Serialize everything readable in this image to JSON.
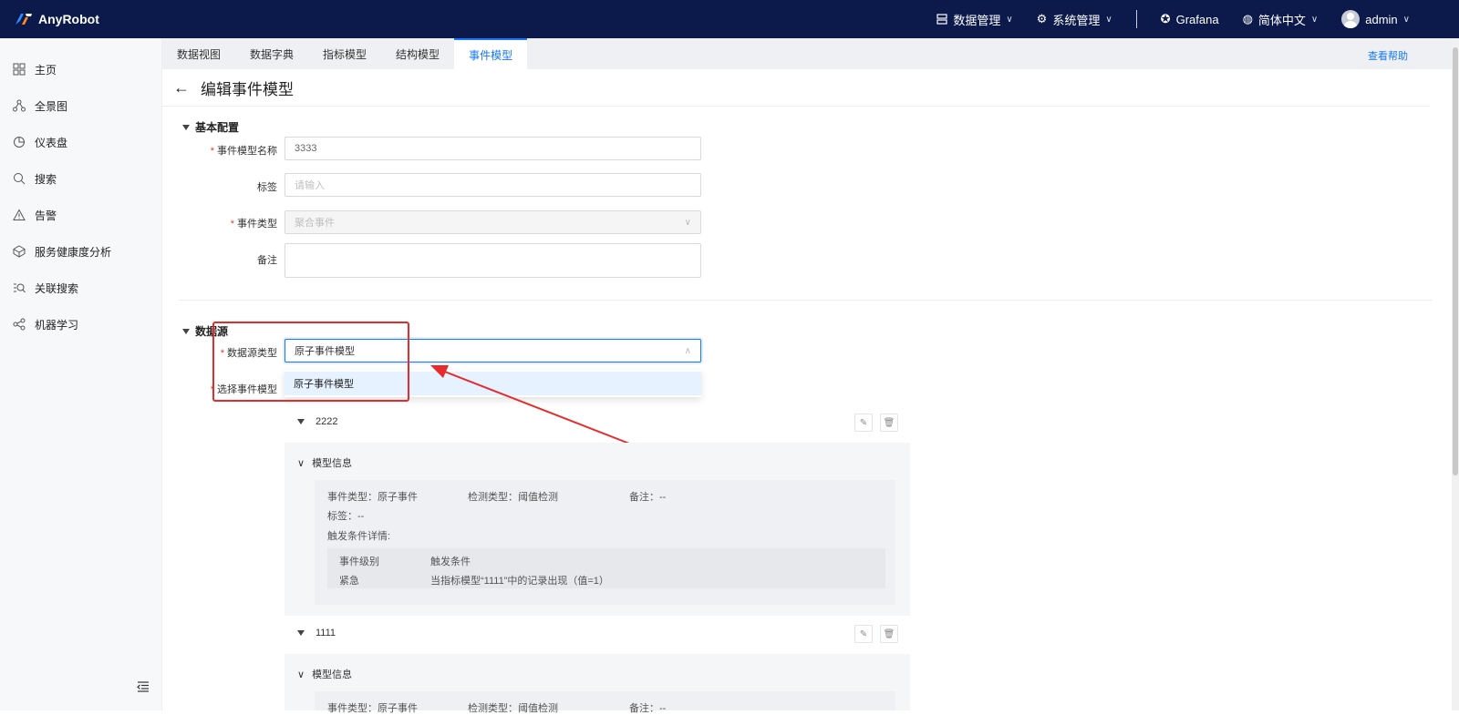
{
  "app": {
    "name": "AnyRobot",
    "colors": {
      "topbar": "#0b1a4a",
      "accent": "#1677ff",
      "required": "#e23a3a",
      "annotation": "#e52b2b"
    }
  },
  "topbar": {
    "data_mgmt": "数据管理",
    "sys_mgmt": "系统管理",
    "grafana": "Grafana",
    "language": "简体中文",
    "user": "admin"
  },
  "sidebar": {
    "items": [
      {
        "label": "主页",
        "icon": "grid-icon"
      },
      {
        "label": "全景图",
        "icon": "topology-icon"
      },
      {
        "label": "仪表盘",
        "icon": "pie-chart-icon"
      },
      {
        "label": "搜索",
        "icon": "search-icon"
      },
      {
        "label": "告警",
        "icon": "warning-icon"
      },
      {
        "label": "服务健康度分析",
        "icon": "box-icon"
      },
      {
        "label": "关联搜索",
        "icon": "list-search-icon"
      },
      {
        "label": "机器学习",
        "icon": "ml-icon"
      }
    ]
  },
  "tabs": [
    {
      "label": "数据视图",
      "active": false
    },
    {
      "label": "数据字典",
      "active": false
    },
    {
      "label": "指标模型",
      "active": false
    },
    {
      "label": "结构模型",
      "active": false
    },
    {
      "label": "事件模型",
      "active": true
    }
  ],
  "help_link": "查看帮助",
  "page": {
    "title": "编辑事件模型"
  },
  "basic": {
    "section_title": "基本配置",
    "name_label": "事件模型名称",
    "name_value": "3333",
    "tag_label": "标签",
    "tag_placeholder": "请输入",
    "type_label": "事件类型",
    "type_value": "聚合事件",
    "note_label": "备注"
  },
  "datasource": {
    "section_title": "数据源",
    "type_label": "数据源类型",
    "type_value": "原子事件模型",
    "option": "原子事件模型",
    "select_label": "选择事件模型"
  },
  "models": [
    {
      "name": "2222",
      "info_title": "模型信息",
      "event_type": "事件类型：原子事件",
      "detect_type": "检测类型：阈值检测",
      "note": "备注：--",
      "tags": "标签：--",
      "trigger_title": "触发条件详情:",
      "col_level": "事件级别",
      "col_condition": "触发条件",
      "level": "紧急",
      "condition": "当指标模型“1111”中的记录出现（值=1）"
    },
    {
      "name": "1111",
      "info_title": "模型信息",
      "event_type": "事件类型：原子事件",
      "detect_type": "检测类型：阈值检测",
      "note": "备注：--"
    }
  ]
}
